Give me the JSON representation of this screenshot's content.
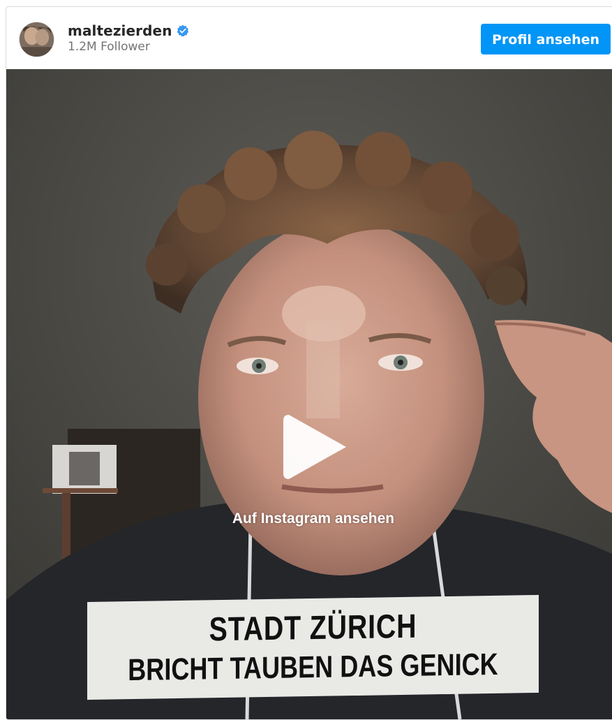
{
  "post": {
    "username": "maltezierden",
    "followers": "1.2M Follower",
    "profile_button": "Profil ansehen",
    "verified_icon": "verified-badge-icon"
  },
  "video": {
    "watch_label": "Auf Instagram ansehen",
    "play_icon": "play-icon",
    "caption_line1": "STADT ZÜRICH",
    "caption_line2": "BRICHT TAUBEN DAS GENICK"
  },
  "colors": {
    "accent": "#0095f6",
    "username": "#262626",
    "followers": "#737373"
  }
}
